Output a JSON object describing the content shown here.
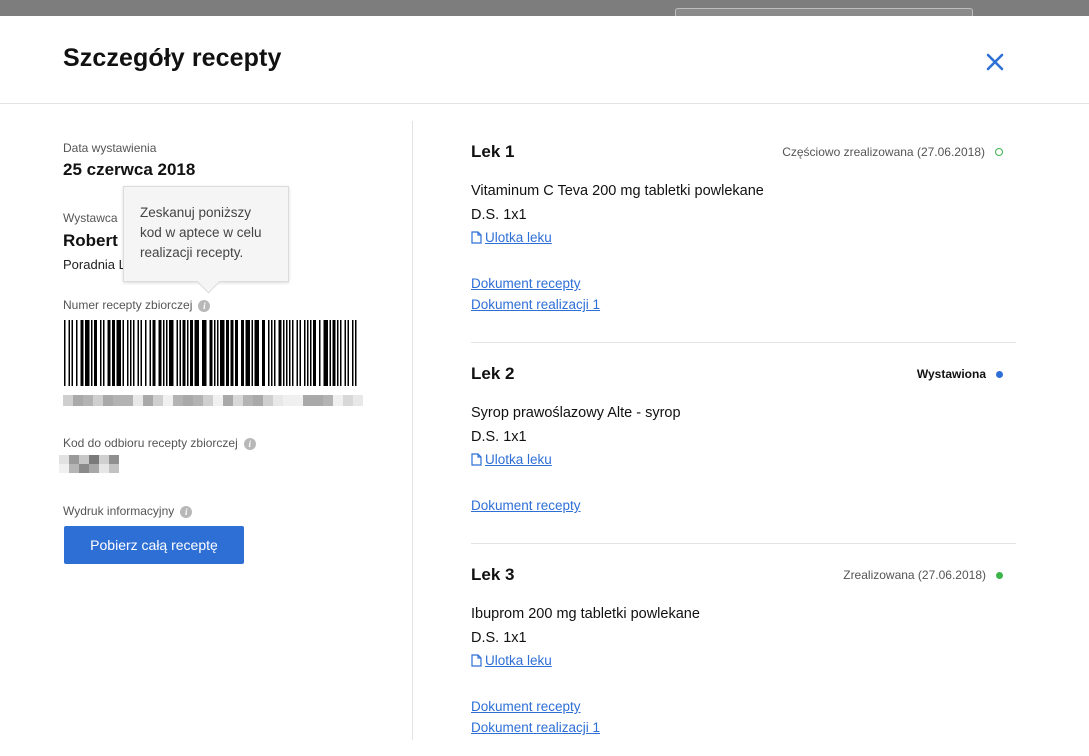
{
  "modal": {
    "title": "Szczegóły recepty"
  },
  "left": {
    "issue_date_label": "Data wystawienia",
    "issue_date_value": "25 czerwca 2018",
    "issuer_label": "Wystawca",
    "issuer_name": "Robert S",
    "issuer_clinic": "Poradnia L",
    "tooltip_text": "Zeskanuj poniższy kod w aptece w celu realizacji recepty.",
    "collective_number_label": "Numer recepty zbiorczej",
    "pickup_code_label": "Kod do odbioru recepty zbiorczej",
    "printout_label": "Wydruk informacyjny",
    "download_button": "Pobierz całą receptę"
  },
  "medications": [
    {
      "title": "Lek 1",
      "status": "Częściowo zrealizowana (27.06.2018)",
      "name": "Vitaminum C Teva 200 mg tabletki powlekane",
      "dosage": "D.S. 1x1",
      "leaflet": "Ulotka leku",
      "doc": "Dokument recepty",
      "fulfilment_doc": "Dokument realizacji 1",
      "status_color": "#3bb54a"
    },
    {
      "title": "Lek 2",
      "status": "Wystawiona",
      "name": "Syrop prawoślazowy Alte - syrop",
      "dosage": "D.S. 1x1",
      "leaflet": "Ulotka leku",
      "doc": "Dokument recepty",
      "status_color": "#2e6fd6"
    },
    {
      "title": "Lek 3",
      "status": "Zrealizowana (27.06.2018)",
      "name": "Ibuprom 200 mg tabletki powlekane",
      "dosage": "D.S. 1x1",
      "leaflet": "Ulotka leku",
      "doc": "Dokument recepty",
      "fulfilment_doc": "Dokument realizacji 1",
      "status_color": "#3bb54a"
    }
  ],
  "colors": {
    "accent": "#2e6fd6",
    "divider": "#e3e3e3"
  }
}
